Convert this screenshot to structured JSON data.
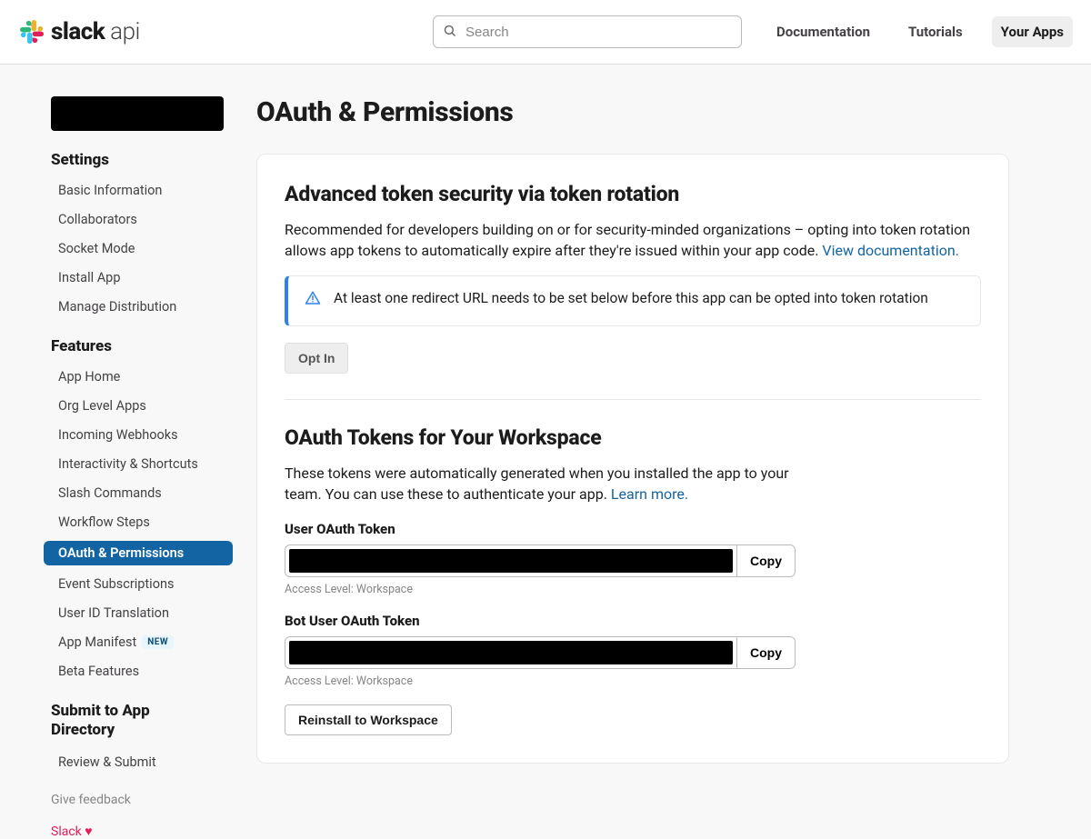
{
  "header": {
    "brand_bold": "slack",
    "brand_thin": " api",
    "search_placeholder": "Search",
    "nav": {
      "documentation": "Documentation",
      "tutorials": "Tutorials",
      "your_apps": "Your Apps"
    }
  },
  "sidebar": {
    "settings_heading": "Settings",
    "settings": [
      {
        "label": "Basic Information"
      },
      {
        "label": "Collaborators"
      },
      {
        "label": "Socket Mode"
      },
      {
        "label": "Install App"
      },
      {
        "label": "Manage Distribution"
      }
    ],
    "features_heading": "Features",
    "features": [
      {
        "label": "App Home"
      },
      {
        "label": "Org Level Apps"
      },
      {
        "label": "Incoming Webhooks"
      },
      {
        "label": "Interactivity & Shortcuts"
      },
      {
        "label": "Slash Commands"
      },
      {
        "label": "Workflow Steps"
      },
      {
        "label": "OAuth & Permissions",
        "active": true
      },
      {
        "label": "Event Subscriptions"
      },
      {
        "label": "User ID Translation"
      },
      {
        "label": "App Manifest",
        "badge": "NEW"
      },
      {
        "label": "Beta Features"
      }
    ],
    "submit_heading": "Submit to App Directory",
    "submit": [
      {
        "label": "Review & Submit"
      }
    ],
    "give_feedback": "Give feedback",
    "slack_love": "Slack ♥"
  },
  "page": {
    "title": "OAuth & Permissions",
    "rotation": {
      "heading": "Advanced token security via token rotation",
      "body": "Recommended for developers building on or for security-minded organizations – opting into token rotation allows app tokens to automatically expire after they're issued within your app code. ",
      "doc_link": "View documentation.",
      "notice": "At least one redirect URL needs to be set below before this app can be opted into token rotation",
      "opt_in": "Opt In"
    },
    "tokens": {
      "heading": "OAuth Tokens for Your Workspace",
      "body": "These tokens were automatically generated when you installed the app to your team. You can use these to authenticate your app. ",
      "learn_more": "Learn more.",
      "user_label": "User OAuth Token",
      "bot_label": "Bot User OAuth Token",
      "copy": "Copy",
      "access_level": "Access Level: Workspace",
      "reinstall": "Reinstall to Workspace"
    }
  }
}
